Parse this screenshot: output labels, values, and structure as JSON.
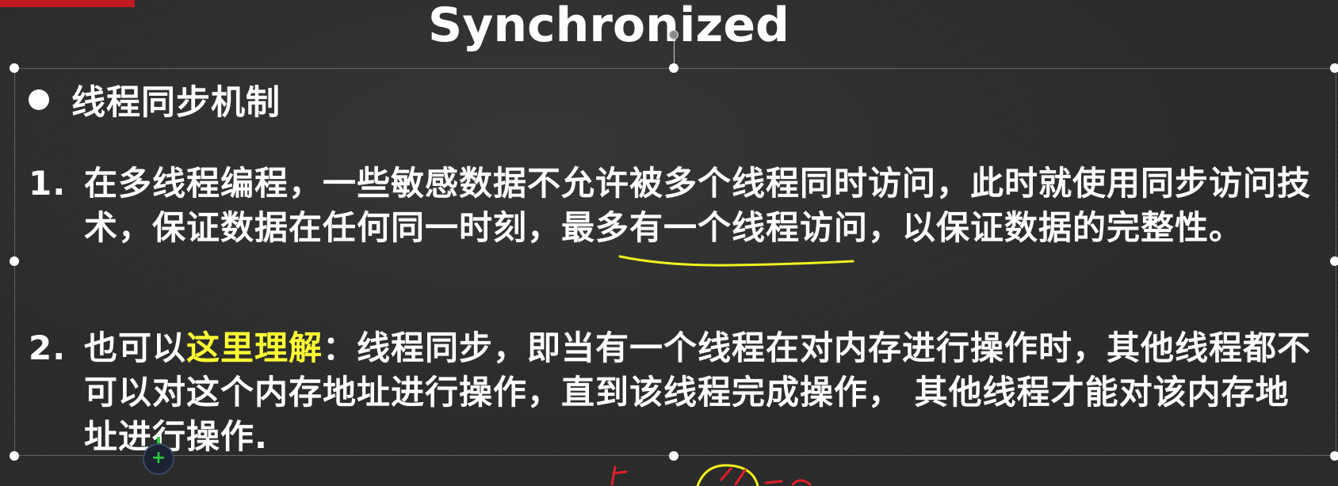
{
  "slide": {
    "title": "Synchronized",
    "bullet": "线程同步机制",
    "items": [
      {
        "number": "1.",
        "lines": [
          "在多线程编程，一些敏感数据不允许被多个线程同时访问，此时就使用同步访问技",
          "术，保证数据在任何同一时刻，最多有一个线程访问，以保证数据的完整性。"
        ]
      },
      {
        "number": "2.",
        "line1_prefix": "也可以",
        "line1_highlight": "这里理解",
        "line1_suffix": "：线程同步，即当有一个线程在对内存进行操作时，其他线程都不",
        "lines_rest": [
          "可以对这个内存地址进行操作，直到该线程完成操作， 其他线程才能对该内存地",
          "址进行操作."
        ]
      }
    ]
  },
  "colors": {
    "background": "#2b2b2b",
    "text": "#ffffff",
    "highlight": "#ffff33",
    "accent_tab": "#c0181e",
    "annotation_yellow": "#f2f21e",
    "annotation_red": "#e0202a",
    "cursor_green": "#2ecc40"
  },
  "icons": {
    "cursor": "add-cursor-icon",
    "rotate_handle": "rotate-handle-icon"
  }
}
